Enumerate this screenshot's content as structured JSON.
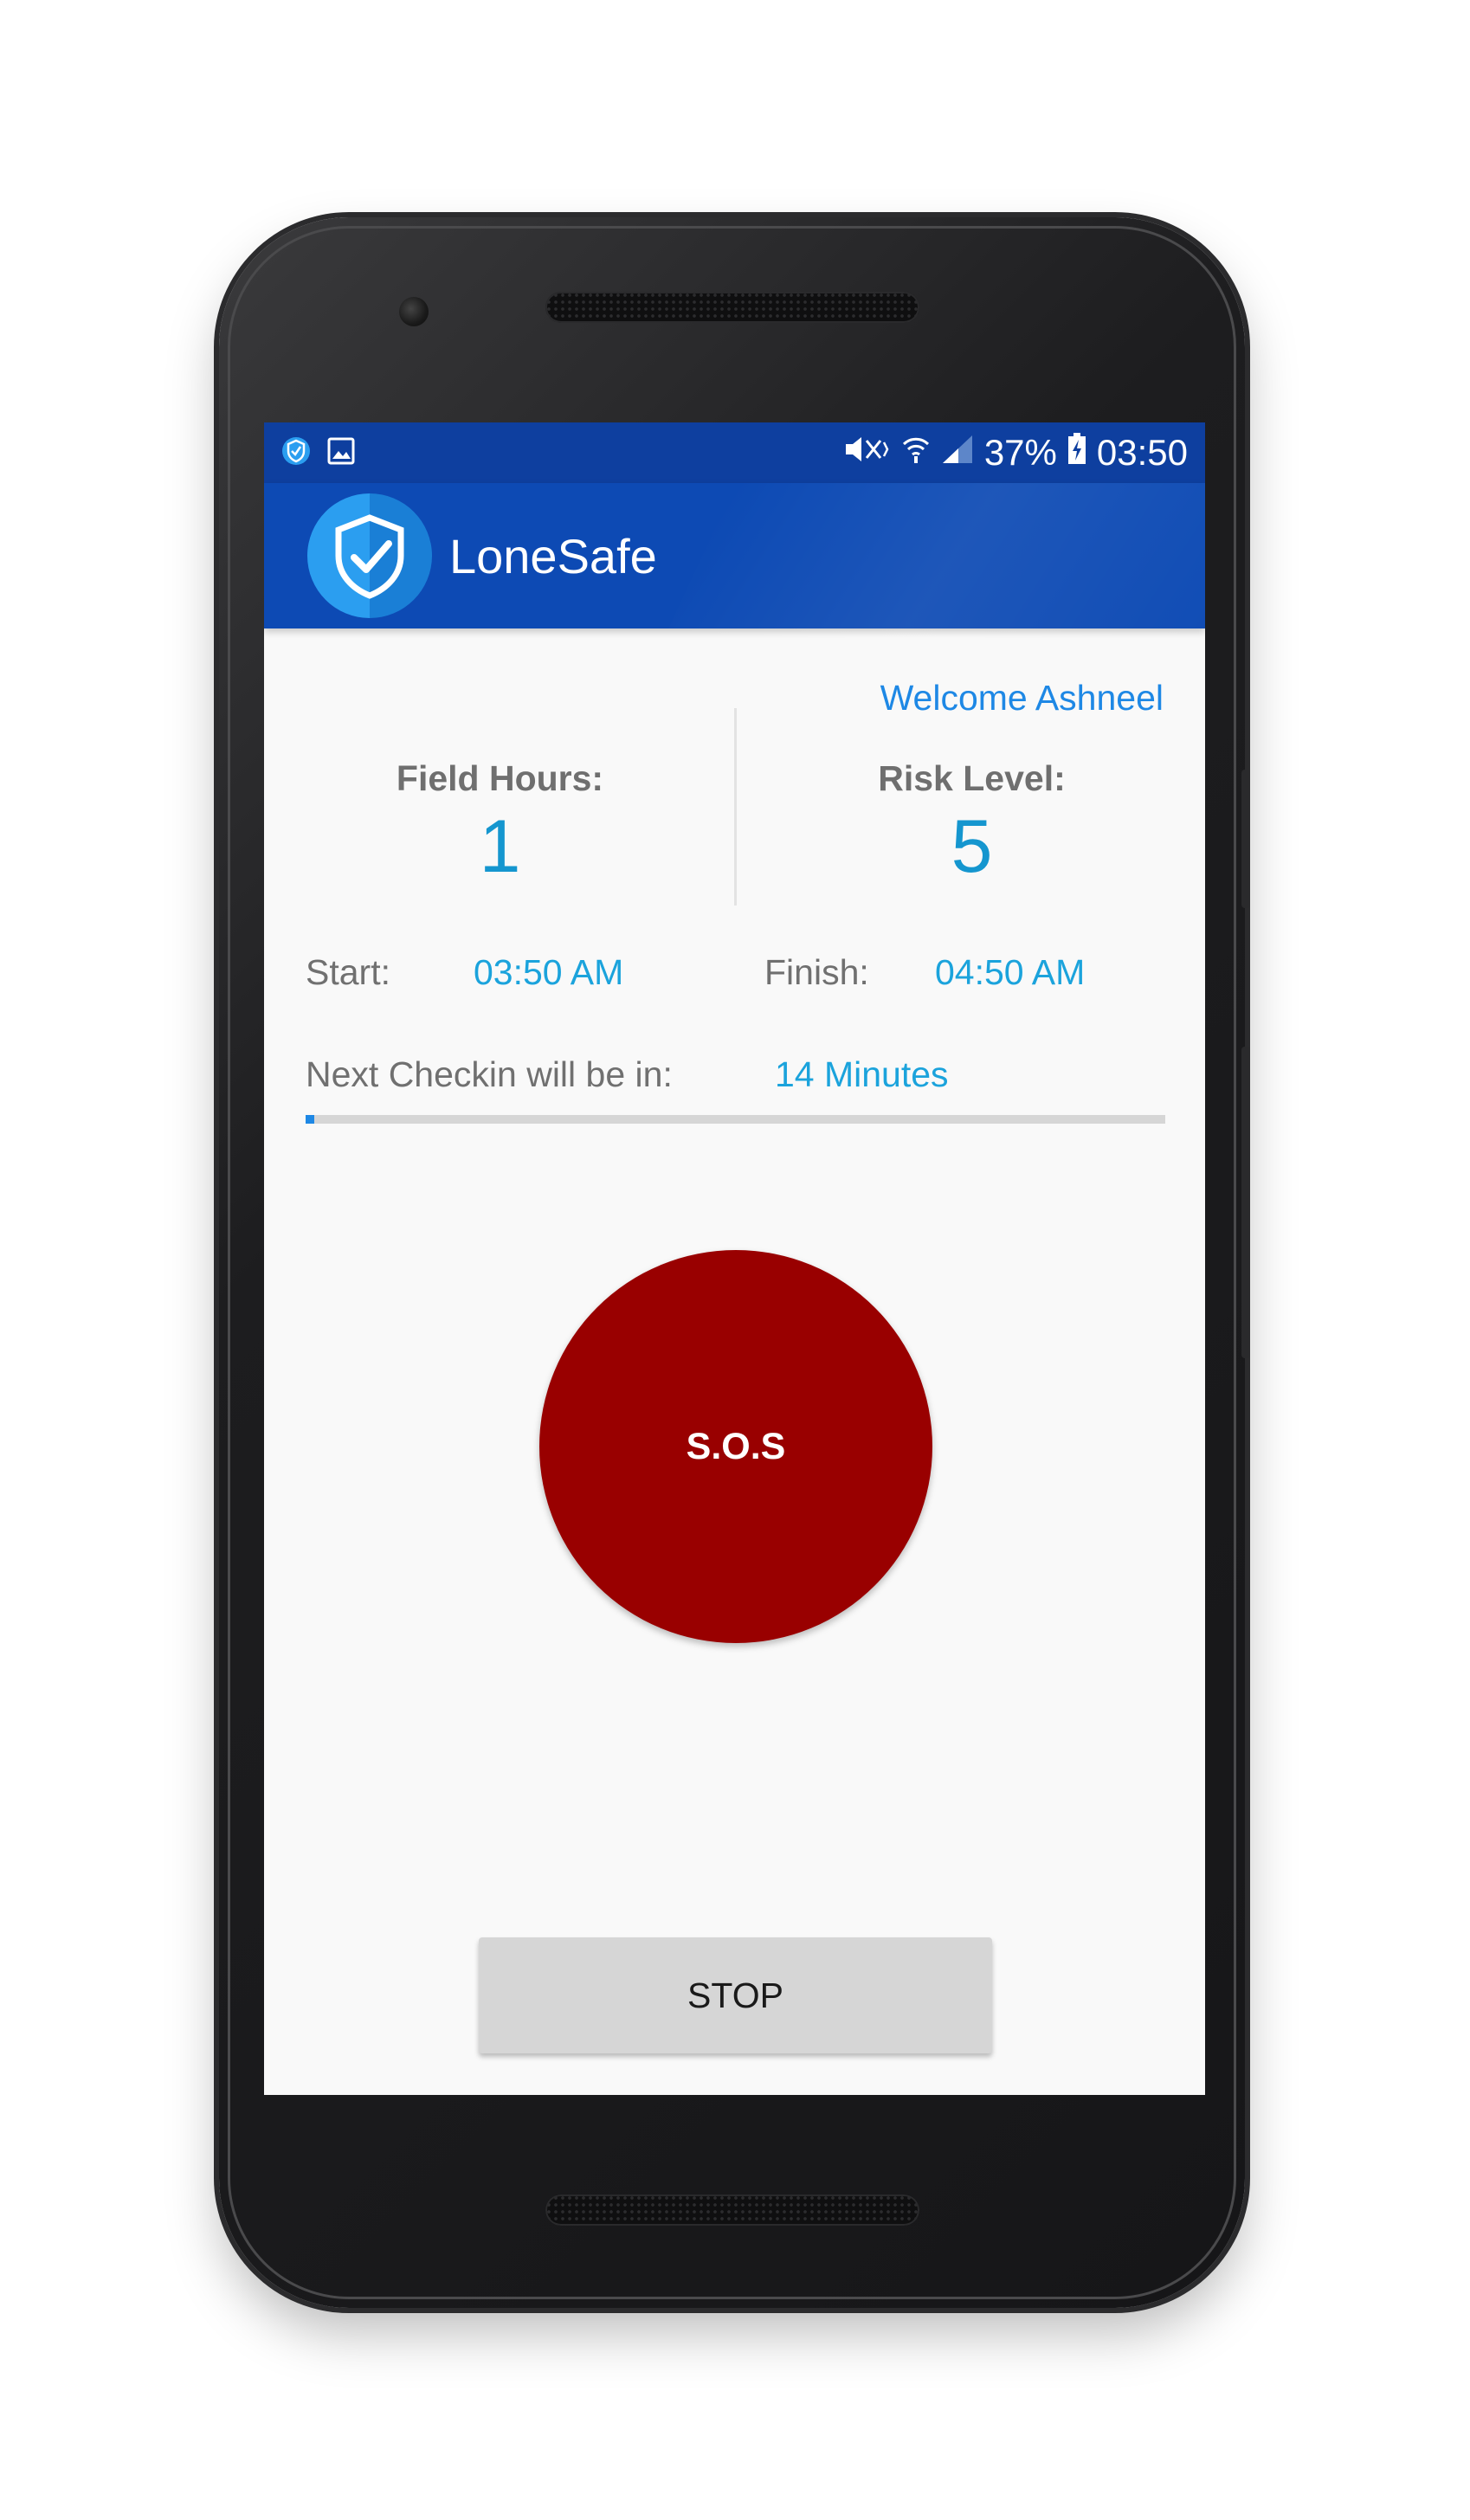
{
  "status_bar": {
    "battery": "37%",
    "time": "03:50",
    "icons": [
      "shield-notification-icon",
      "image-notification-icon",
      "mute-icon",
      "wifi-icon",
      "signal-icon",
      "battery-charging-icon"
    ]
  },
  "app_bar": {
    "title": "LoneSafe",
    "logo_icon": "shield-check-icon",
    "color": "#0d4ab4"
  },
  "welcome": "Welcome Ashneel",
  "stats": {
    "field_hours": {
      "label": "Field Hours:",
      "value": "1"
    },
    "risk_level": {
      "label": "Risk Level:",
      "value": "5"
    }
  },
  "times": {
    "start_label": "Start:",
    "start_value": "03:50 AM",
    "finish_label": "Finish:",
    "finish_value": "04:50 AM"
  },
  "checkin": {
    "label": "Next Checkin will be in:",
    "value": "14 Minutes",
    "progress_fraction": 0.01
  },
  "sos_button": {
    "label": "S.O.S",
    "color": "#990000"
  },
  "stop_button": {
    "label": "STOP"
  },
  "colors": {
    "accent": "#1e88e5",
    "value_text": "#1596cf",
    "status_bar": "#0e3f9f"
  }
}
